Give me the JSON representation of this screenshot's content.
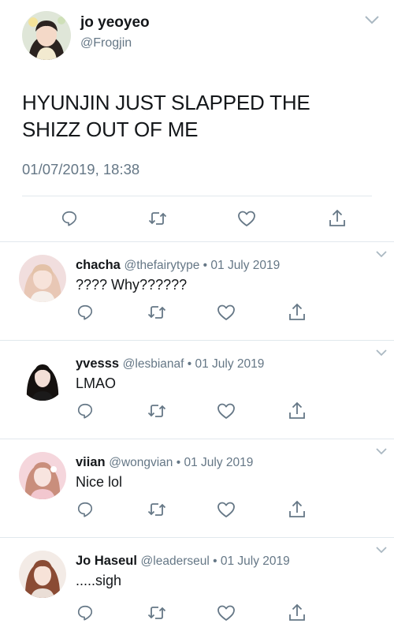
{
  "main_tweet": {
    "display_name": "jo yeoyeo",
    "handle": "@Frogjin",
    "text": "HYUNJIN JUST SLAPPED THE SHIZZ OUT OF ME",
    "timestamp": "01/07/2019, 18:38",
    "actions": [
      "reply-icon",
      "retweet-icon",
      "like-icon",
      "share-icon"
    ]
  },
  "replies": [
    {
      "display_name": "chacha",
      "handle": "@thefairytype",
      "separator": " • ",
      "date": "01 July 2019",
      "text": "???? Why??????"
    },
    {
      "display_name": "yvesss",
      "handle": "@lesbianaf",
      "separator": " • ",
      "date": "01 July 2019",
      "text": "LMAO"
    },
    {
      "display_name": "viian",
      "handle": "@wongvian",
      "separator": " • ",
      "date": "01 July 2019",
      "text": "Nice lol"
    },
    {
      "display_name": "Jo Haseul",
      "handle": "@leaderseul",
      "separator": " • ",
      "date": "01 July 2019",
      "text": ".....sigh"
    }
  ],
  "colors": {
    "text": "#14171a",
    "secondary": "#657786",
    "divider": "#e1e8ed",
    "icon": "#657786"
  }
}
